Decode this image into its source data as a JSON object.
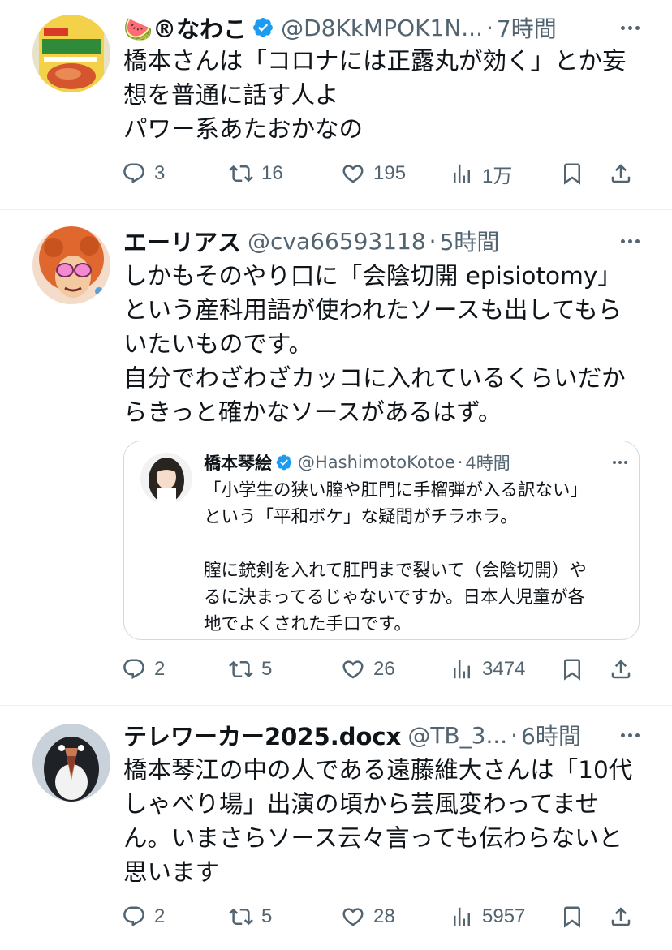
{
  "tweets": [
    {
      "display_name": "🍉®なわこ",
      "handle": "@D8KkMPOK1N...",
      "time": "7時間",
      "lines": [
        "橋本さんは「コロナには正露丸が効く」とか妄",
        "想を普通に話す人よ",
        "パワー系あたおかなの"
      ],
      "replies": "3",
      "retweets": "16",
      "likes": "195",
      "views": "1万"
    },
    {
      "display_name": "エーリアス",
      "handle": "@cva66593118",
      "time": "5時間",
      "lines": [
        "しかもそのやり口に「会陰切開 episiotomy」",
        "という産科用語が使われたソースも出してもら",
        "いたいものです。",
        "自分でわざわざカッコに入れているくらいだか",
        "らきっと確かなソースがあるはず。"
      ],
      "quote": {
        "display_name": "橋本琴絵",
        "handle": "@HashimotoKotoe",
        "time": "4時間",
        "lines": [
          "「小学生の狭い膣や肛門に手榴弾が入る訳ない」",
          "という「平和ボケ」な疑問がチラホラ。",
          "",
          "膣に銃剣を入れて肛門まで裂いて（会陰切開）や",
          "るに決まってるじゃないですか。日本人児童が各",
          "地でよくされた手口です。"
        ]
      },
      "replies": "2",
      "retweets": "5",
      "likes": "26",
      "views": "3474"
    },
    {
      "display_name": "テレワーカー2025.docx",
      "handle": "@TB_3...",
      "time": "6時間",
      "lines": [
        "橋本琴江の中の人である遠藤維大さんは「10代",
        "しゃべり場」出演の頃から芸風変わってませ",
        "ん。いまさらソース云々言っても伝わらないと",
        "思います"
      ],
      "replies": "2",
      "retweets": "5",
      "likes": "28",
      "views": "5957"
    }
  ],
  "ui": {
    "dot": "·",
    "colors": {
      "text": "#0f1419",
      "secondary": "#536471",
      "verified": "#1d9bf0",
      "border": "#cfd9de"
    }
  }
}
